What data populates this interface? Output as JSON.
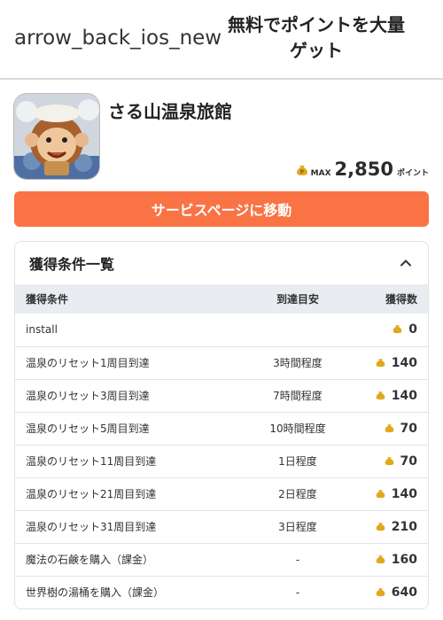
{
  "header": {
    "back_icon_text": "arrow_back_ios_new",
    "title": "無料でポイントを大量ゲット"
  },
  "app": {
    "name": "さる山温泉旅館",
    "max_label": "MAX",
    "points": "2,850",
    "points_unit": "ポイント"
  },
  "service_button": "サービスページに移動",
  "conditions": {
    "title": "獲得条件一覧",
    "columns": [
      "獲得条件",
      "到達目安",
      "獲得数"
    ],
    "rows": [
      {
        "condition": "install",
        "estimate": "",
        "points": "0"
      },
      {
        "condition": "温泉のリセット1周目到達",
        "estimate": "3時間程度",
        "points": "140"
      },
      {
        "condition": "温泉のリセット3周目到達",
        "estimate": "7時間程度",
        "points": "140"
      },
      {
        "condition": "温泉のリセット5周目到達",
        "estimate": "10時間程度",
        "points": "70"
      },
      {
        "condition": "温泉のリセット11周目到達",
        "estimate": "1日程度",
        "points": "70"
      },
      {
        "condition": "温泉のリセット21周目到達",
        "estimate": "2日程度",
        "points": "140"
      },
      {
        "condition": "温泉のリセット31周目到達",
        "estimate": "3日程度",
        "points": "210"
      },
      {
        "condition": "魔法の石鹸を購入（課金）",
        "estimate": "-",
        "points": "160"
      },
      {
        "condition": "世界樹の湯桶を購入（課金）",
        "estimate": "-",
        "points": "640"
      }
    ]
  }
}
